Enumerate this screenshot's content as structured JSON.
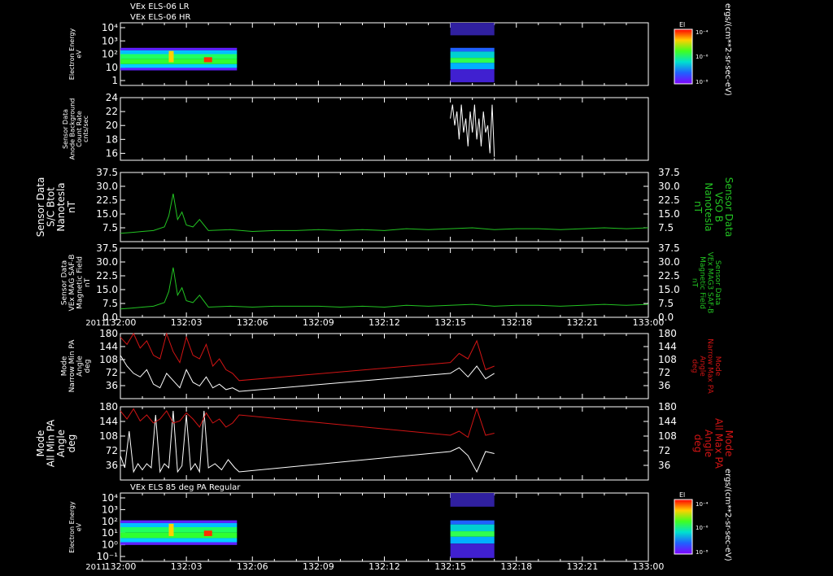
{
  "header": {
    "line1": "VEx ELS-06 LR",
    "line2": "VEx ELS-06 HR",
    "bottom_title": "VEx ELS 85 deg PA Regular"
  },
  "time_axis": {
    "year": "2011",
    "ticks": [
      "132:00",
      "132:03",
      "132:06",
      "132:09",
      "132:12",
      "132:15",
      "132:18",
      "132:21",
      "133:00"
    ]
  },
  "colorbar": {
    "title": "El",
    "unit_label": "ergs/(cm**2-sr-sec-eV)",
    "ticks": [
      "10⁻⁴",
      "10⁻⁶",
      "10⁻⁸"
    ]
  },
  "chart_data": [
    {
      "type": "heatmap",
      "name": "panel1",
      "ylabel": [
        "Electron Energy",
        "eV"
      ],
      "yticks": [
        "10⁴",
        "10³",
        "10²",
        "10",
        "1"
      ],
      "blocks": [
        {
          "x_start": "132:00",
          "x_end": "132:05.3"
        },
        {
          "x_start": "132:15",
          "x_end": "132:17"
        }
      ]
    },
    {
      "type": "line",
      "name": "panel2",
      "ylabel": [
        "Sensor Data",
        "Anode Background",
        "Count Rate",
        "cnts/sec"
      ],
      "ylim": [
        15,
        24
      ],
      "yticks": [
        "24",
        "22",
        "20",
        "18",
        "16"
      ],
      "series": [
        {
          "color": "#ffffff",
          "x": [
            15.0,
            15.1,
            15.2,
            15.3,
            15.4,
            15.5,
            15.6,
            15.7,
            15.8,
            15.9,
            16.0,
            16.1,
            16.2,
            16.3,
            16.4,
            16.5,
            16.6,
            16.7,
            16.8,
            16.9,
            17.0
          ],
          "y": [
            21,
            23,
            20,
            22,
            18,
            23,
            19,
            21,
            17,
            22,
            19,
            23,
            18,
            21,
            17,
            22,
            19,
            20,
            16,
            23,
            15.5
          ]
        }
      ]
    },
    {
      "type": "line",
      "name": "panel3",
      "ylabel": [
        "Sensor Data",
        "S/C Btot",
        "Nanotesla",
        "nT"
      ],
      "rlabel": [
        "Sensor Data",
        "VSO B",
        "Nanotesla",
        "nT"
      ],
      "ylim": [
        0,
        37.5
      ],
      "yticks": [
        "37.5",
        "30.0",
        "22.5",
        "15.0",
        "7.5"
      ],
      "series": [
        {
          "color": "#22c322",
          "x": [
            0,
            0.5,
            1.0,
            1.5,
            2.0,
            2.2,
            2.4,
            2.6,
            2.8,
            3.0,
            3.3,
            3.6,
            4.0,
            5,
            6,
            7,
            8,
            9,
            10,
            11,
            12,
            13,
            14,
            15,
            16,
            17,
            18,
            19,
            20,
            21,
            22,
            23,
            24
          ],
          "y": [
            4.5,
            5,
            5.5,
            6,
            8,
            14,
            26,
            12,
            16,
            9,
            8,
            12,
            6,
            6.5,
            5.5,
            6,
            6,
            6.5,
            6,
            6.5,
            6,
            7,
            6.5,
            7,
            7.5,
            6.5,
            7,
            7,
            6.5,
            7,
            7.5,
            7,
            7.5
          ]
        }
      ]
    },
    {
      "type": "line",
      "name": "panel4",
      "ylabel": [
        "Sensor Data",
        "VEx MAG SAF-B",
        "Magnetic Field",
        "nT"
      ],
      "rlabel": [
        "Sensor Data",
        "VEx MAG3 SAF-B",
        "Magnetic Field",
        "nT"
      ],
      "ylim": [
        0,
        37.5
      ],
      "yticks": [
        "37.5",
        "30.0",
        "22.5",
        "15.0",
        "7.5",
        "0.0"
      ],
      "series": [
        {
          "color": "#22c322",
          "x": [
            0,
            0.5,
            1.0,
            1.5,
            2.0,
            2.2,
            2.4,
            2.6,
            2.8,
            3.0,
            3.3,
            3.6,
            4.0,
            5,
            6,
            7,
            8,
            9,
            10,
            11,
            12,
            13,
            14,
            15,
            16,
            17,
            18,
            19,
            20,
            21,
            22,
            23,
            24
          ],
          "y": [
            4.5,
            5,
            5.5,
            6,
            8,
            14,
            27,
            12,
            16,
            9,
            8,
            12,
            5.5,
            6,
            5.5,
            6,
            6,
            6,
            5.5,
            6,
            5.5,
            6.5,
            6,
            6.5,
            7,
            6,
            6.5,
            6.5,
            6,
            6.5,
            7,
            6.5,
            7
          ]
        }
      ]
    },
    {
      "type": "line",
      "name": "panel5",
      "ylabel": [
        "Mode",
        "Narrow Min PA",
        "Angle",
        "deg"
      ],
      "rlabel": [
        "Mode",
        "Narrow Max PA",
        "Angle",
        "deg"
      ],
      "ylim": [
        0,
        180
      ],
      "yticks": [
        "180",
        "144",
        "108",
        "72",
        "36"
      ],
      "series": [
        {
          "color": "#ffffff",
          "x": [
            0,
            0.3,
            0.6,
            0.9,
            1.2,
            1.5,
            1.8,
            2.1,
            2.4,
            2.7,
            3.0,
            3.3,
            3.6,
            3.9,
            4.2,
            4.5,
            4.8,
            5.1,
            5.4,
            15,
            15.4,
            15.8,
            16.2,
            16.6,
            17
          ],
          "y": [
            120,
            90,
            70,
            60,
            80,
            40,
            30,
            70,
            50,
            30,
            80,
            45,
            35,
            60,
            30,
            40,
            25,
            30,
            20,
            70,
            85,
            60,
            90,
            55,
            70
          ]
        },
        {
          "color": "#d21414",
          "x": [
            0,
            0.3,
            0.6,
            0.9,
            1.2,
            1.5,
            1.8,
            2.1,
            2.4,
            2.7,
            3.0,
            3.3,
            3.6,
            3.9,
            4.2,
            4.5,
            4.8,
            5.1,
            5.4,
            15,
            15.4,
            15.8,
            16.2,
            16.6,
            17
          ],
          "y": [
            170,
            150,
            180,
            140,
            160,
            120,
            110,
            180,
            130,
            100,
            170,
            120,
            110,
            150,
            90,
            110,
            80,
            70,
            50,
            100,
            125,
            110,
            160,
            80,
            90
          ]
        }
      ]
    },
    {
      "type": "line",
      "name": "panel6",
      "ylabel": [
        "Mode",
        "All Min PA",
        "Angle",
        "deg"
      ],
      "rlabel": [
        "Mode",
        "All Max PA",
        "Angle",
        "deg"
      ],
      "ylim": [
        0,
        180
      ],
      "yticks": [
        "180",
        "144",
        "108",
        "72",
        "36"
      ],
      "series": [
        {
          "color": "#ffffff",
          "x": [
            0,
            0.2,
            0.4,
            0.6,
            0.8,
            1.0,
            1.2,
            1.4,
            1.6,
            1.8,
            2.0,
            2.2,
            2.4,
            2.6,
            2.8,
            3.0,
            3.2,
            3.4,
            3.6,
            3.8,
            4.0,
            4.3,
            4.6,
            4.9,
            5.2,
            5.4,
            15,
            15.4,
            15.8,
            16.2,
            16.6,
            17
          ],
          "y": [
            60,
            30,
            120,
            20,
            40,
            25,
            40,
            30,
            160,
            20,
            40,
            30,
            170,
            20,
            35,
            160,
            25,
            40,
            20,
            170,
            30,
            40,
            25,
            50,
            30,
            20,
            70,
            80,
            60,
            20,
            70,
            65
          ]
        },
        {
          "color": "#d21414",
          "x": [
            0,
            0.3,
            0.6,
            0.9,
            1.2,
            1.5,
            1.8,
            2.1,
            2.4,
            2.7,
            3.0,
            3.3,
            3.6,
            3.9,
            4.2,
            4.5,
            4.8,
            5.1,
            5.4,
            15,
            15.4,
            15.8,
            16.2,
            16.6,
            17
          ],
          "y": [
            170,
            150,
            175,
            145,
            160,
            140,
            150,
            170,
            140,
            145,
            165,
            150,
            130,
            165,
            140,
            150,
            130,
            140,
            160,
            110,
            120,
            105,
            175,
            110,
            115
          ]
        }
      ]
    },
    {
      "type": "heatmap",
      "name": "panel7",
      "ylabel": [
        "Electron Energy",
        "eV"
      ],
      "yticks": [
        "10⁴",
        "10³",
        "10²",
        "10¹",
        "10⁰",
        "10⁻¹"
      ],
      "blocks": [
        {
          "x_start": "132:00",
          "x_end": "132:05.3"
        },
        {
          "x_start": "132:15",
          "x_end": "132:17"
        }
      ]
    }
  ]
}
